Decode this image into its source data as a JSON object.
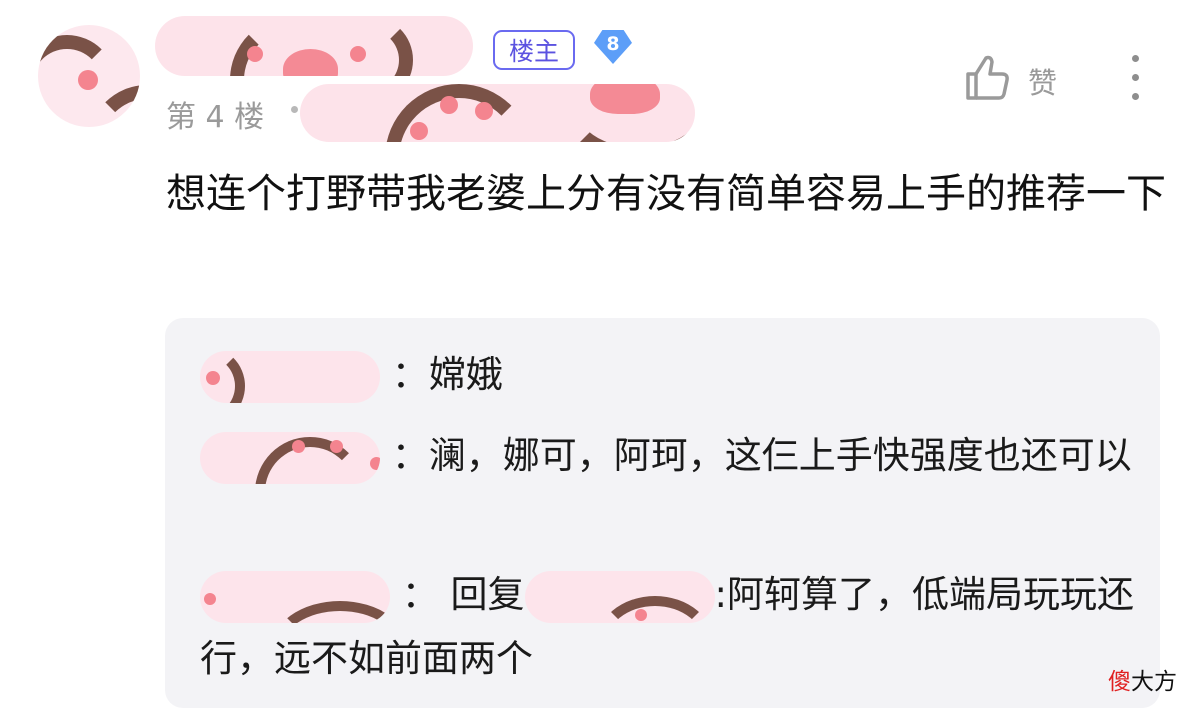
{
  "post": {
    "floor_label": "第 4 楼",
    "host_badge": "楼主",
    "level": "8",
    "content": "想连个打野带我老婆上分有没有简单容易上手的推荐一下",
    "like_label": "赞"
  },
  "replies": [
    {
      "text": "嫦娥"
    },
    {
      "text": "澜，娜可，阿珂，这仨上手快强度也还可以"
    },
    {
      "reply_prefix": "回复",
      "text": ":阿轲算了，低端局玩玩还行，远不如前面两个"
    }
  ],
  "watermark": {
    "first": "傻",
    "rest": "大方"
  },
  "colors": {
    "accent": "#5b52e0",
    "level_badge": "#5c9ef8",
    "reply_bg": "#f3f3f6",
    "muted": "#9a9a9a"
  },
  "icons": [
    "avatar",
    "thumbs-up-icon",
    "more-vertical-icon",
    "level-diamond-icon"
  ]
}
